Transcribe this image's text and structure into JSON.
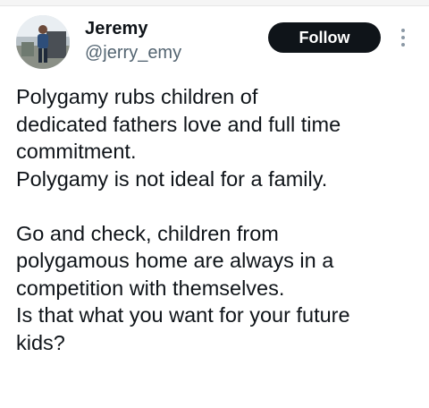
{
  "tweet": {
    "author": {
      "name": "Jeremy",
      "handle": "@jerry_emy"
    },
    "follow_label": "Follow",
    "more_icon": "more-vertical-icon",
    "lines": [
      "Polygamy rubs children of",
      "dedicated fathers love and full time",
      "commitment.",
      "Polygamy is not ideal for a family.",
      "",
      "Go and check, children from",
      "polygamous home are always in a",
      "competition with themselves.",
      "Is that what you want for your future",
      "kids?"
    ]
  },
  "colors": {
    "text_primary": "#0f1419",
    "text_secondary": "#536471",
    "follow_button_bg": "#0f1419",
    "follow_button_text": "#ffffff",
    "more_icon": "#8b98a5"
  }
}
